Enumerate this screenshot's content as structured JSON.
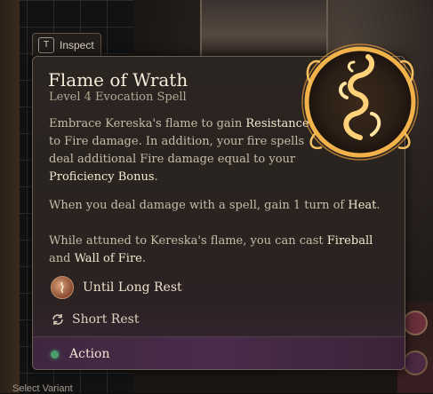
{
  "inspect": {
    "key": "T",
    "label": "Inspect"
  },
  "spell": {
    "name": "Flame of Wrath",
    "level": "Level 4 Evocation Spell",
    "icon": "flame-swirl-icon"
  },
  "description": {
    "p1_a": "Embrace Kereska's flame to gain ",
    "p1_b": "Resistance",
    "p1_c": " to Fire damage. In addition, your fire spells deal additional Fire damage equal to your ",
    "p1_d": "Proficiency Bonus",
    "p1_e": ".",
    "p2_a": "When you deal damage with a spell, gain 1 turn of ",
    "p2_b": "Heat",
    "p2_c": ".",
    "p3_a": "While attuned to Kereska's flame, you can cast ",
    "p3_b": "Fireball",
    "p3_c": " and ",
    "p3_d": "Wall of Fire",
    "p3_e": "."
  },
  "duration": {
    "label": "Until Long Rest",
    "icon": "long-rest-icon"
  },
  "recharge": {
    "label": "Short Rest",
    "icon": "refresh-icon"
  },
  "cost": {
    "label": "Action",
    "color": "#4b9e6e"
  },
  "background": {
    "select_variant": "Select Variant"
  },
  "colors": {
    "accent_gold": "#e8b04a",
    "action_green": "#4b9e6e"
  }
}
